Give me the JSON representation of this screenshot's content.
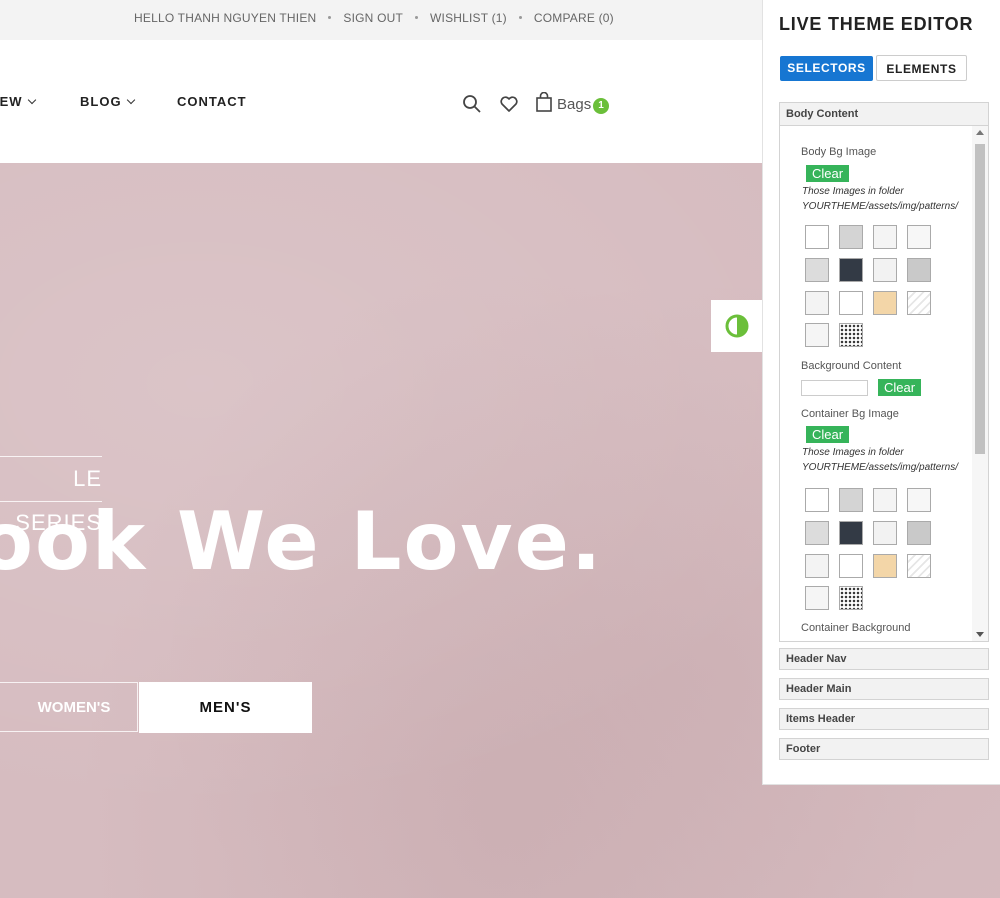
{
  "topbar": {
    "links": [
      "HELLO THANH NGUYEN THIEN",
      "SIGN OUT",
      "WISHLIST (1)",
      "COMPARE (0)"
    ]
  },
  "nav": {
    "items": [
      {
        "label": "IEW",
        "has_dropdown": true
      },
      {
        "label": "BLOG",
        "has_dropdown": true
      },
      {
        "label": "CONTACT",
        "has_dropdown": false
      }
    ]
  },
  "header_actions": {
    "icons": [
      "search-icon",
      "heart-icon",
      "bag-icon"
    ],
    "bags_label": "Bags",
    "bags_count": "1",
    "accent_color": "#6bbf3a"
  },
  "hero": {
    "series_text": "LE SERIES",
    "headline": "ook We Love.",
    "buttons": [
      "WOMEN'S",
      "MEN'S"
    ],
    "background_color": "#d6bcc0"
  },
  "theme_toggle": {
    "icon": "contrast-icon",
    "color": "#6bbf3a"
  },
  "editor": {
    "title": "LIVE THEME EDITOR",
    "tabs": [
      {
        "label": "SELECTORS",
        "active": true
      },
      {
        "label": "ELEMENTS",
        "active": false
      }
    ],
    "open_section": {
      "title": "Body Content",
      "body_bg_image_label": "Body Bg Image",
      "clear_label": "Clear",
      "folder_note_1": "Those Images in folder",
      "folder_note_2": "YOURTHEME/assets/img/patterns/",
      "background_content_label": "Background Content",
      "container_bg_image_label": "Container Bg Image",
      "container_background_label": "Container Background",
      "patterns": [
        "white",
        "light-grey",
        "marble",
        "white-2",
        "grey-texture",
        "dark-navy",
        "light-speckle",
        "grey-noise",
        "light-diagonal",
        "white-3",
        "wood-tan",
        "stripe",
        "circles",
        "dots-dark"
      ]
    },
    "collapsed_sections": [
      "Header Nav",
      "Header Main",
      "Items Header",
      "Footer"
    ],
    "accent_blue": "#1676d2",
    "accent_green": "#36b45a"
  }
}
